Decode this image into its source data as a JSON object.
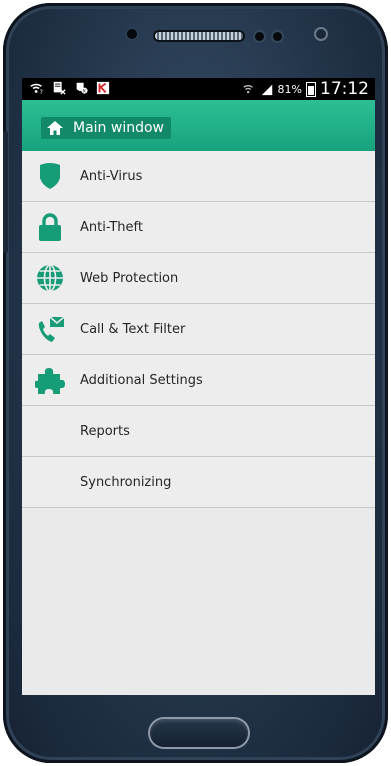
{
  "status_bar": {
    "battery": "81%",
    "time": "17:12",
    "left_icons": [
      "wifi-question-icon",
      "notes-x-icon",
      "shield-k-icon",
      "kaspersky-k-icon"
    ]
  },
  "app_bar": {
    "title": "Main window",
    "icon": "home-icon",
    "accent": "#1fae86"
  },
  "menu": [
    {
      "label": "Anti-Virus",
      "icon": "shield-icon"
    },
    {
      "label": "Anti-Theft",
      "icon": "lock-icon"
    },
    {
      "label": "Web Protection",
      "icon": "globe-icon"
    },
    {
      "label": "Call & Text Filter",
      "icon": "phone-mail-icon"
    },
    {
      "label": "Additional Settings",
      "icon": "puzzle-icon"
    },
    {
      "label": "Reports",
      "icon": ""
    },
    {
      "label": "Synchronizing",
      "icon": ""
    }
  ]
}
